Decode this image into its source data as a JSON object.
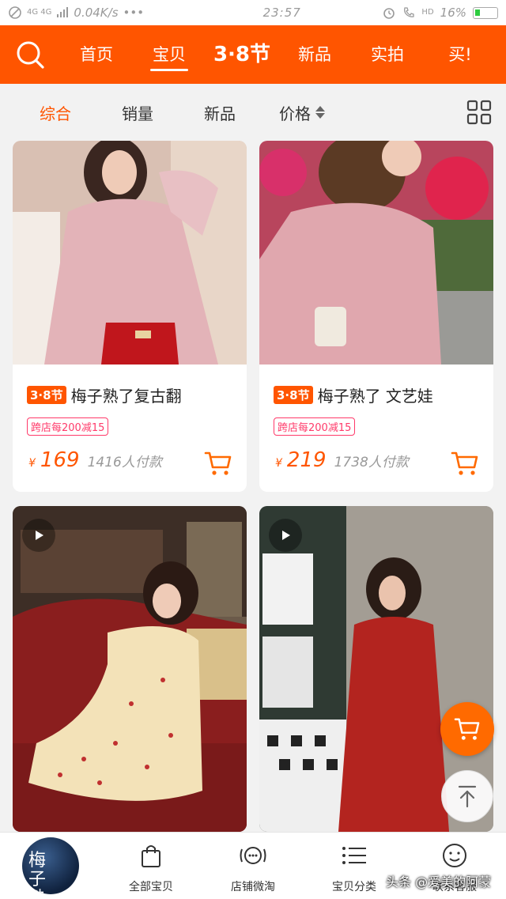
{
  "status_bar": {
    "network": "4G 4G",
    "speed": "0.04K/s",
    "dots": "•••",
    "time": "23:57",
    "hd": "HD",
    "battery": "16%"
  },
  "top_nav": {
    "tabs": [
      {
        "label": "首页"
      },
      {
        "label": "宝贝"
      },
      {
        "label": "3·8节"
      },
      {
        "label": "新品"
      },
      {
        "label": "实拍"
      },
      {
        "label": "买!"
      }
    ]
  },
  "filters": {
    "items": [
      {
        "label": "综合"
      },
      {
        "label": "销量"
      },
      {
        "label": "新品"
      },
      {
        "label": "价格"
      }
    ]
  },
  "products": [
    {
      "tag": "3·8节",
      "title": "梅子熟了复古翻",
      "promo": "跨店每200减15",
      "currency": "¥",
      "price": "169",
      "sold": "1416人付款"
    },
    {
      "tag": "3·8节",
      "title": "梅子熟了 文艺娃",
      "promo": "跨店每200减15",
      "currency": "¥",
      "price": "219",
      "sold": "1738人付款"
    }
  ],
  "bottom_bar": {
    "shop_logo_text": "梅子熟了",
    "tabs": [
      {
        "label": "全部宝贝"
      },
      {
        "label": "店铺微淘"
      },
      {
        "label": "宝贝分类"
      },
      {
        "label": "联系客服"
      }
    ]
  },
  "watermark": "头条 @爱美的阿蒙",
  "colors": {
    "brand_orange": "#ff5500",
    "promo_pink": "#ff3a6a"
  }
}
